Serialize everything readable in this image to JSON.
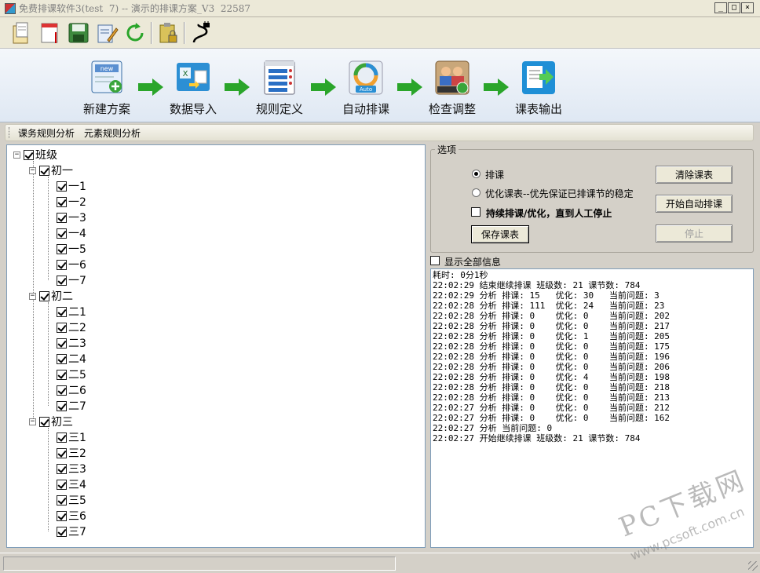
{
  "window": {
    "title": "免费排课软件3(test  7) -- 演示的排课方案_V3  22587",
    "controls": {
      "minimize": "_",
      "maximize": "□",
      "close": "×"
    }
  },
  "quick_toolbar": [
    {
      "icon": "open-folder-icon"
    },
    {
      "icon": "new-document-icon"
    },
    {
      "icon": "save-disk-icon"
    },
    {
      "icon": "edit-document-icon"
    },
    {
      "icon": "refresh-icon"
    },
    {
      "icon": "clipboard-lock-icon"
    },
    {
      "icon": "connect-plug-icon"
    }
  ],
  "workflow": [
    {
      "label": "新建方案",
      "icon": "new-plan-icon"
    },
    {
      "label": "数据导入",
      "icon": "data-import-icon"
    },
    {
      "label": "规则定义",
      "icon": "rule-list-icon"
    },
    {
      "label": "自动排课",
      "icon": "auto-schedule-icon"
    },
    {
      "label": "检查调整",
      "icon": "check-adjust-icon"
    },
    {
      "label": "课表输出",
      "icon": "export-icon"
    }
  ],
  "analysis_bar": {
    "course_rule": "课务规则分析",
    "element_rule": "元素规则分析"
  },
  "tree": {
    "root": "班级",
    "grades": [
      {
        "name": "初一",
        "classes": [
          "一1",
          "一2",
          "一3",
          "一4",
          "一5",
          "一6",
          "一7"
        ]
      },
      {
        "name": "初二",
        "classes": [
          "二1",
          "二2",
          "二3",
          "二4",
          "二5",
          "二6",
          "二7"
        ]
      },
      {
        "name": "初三",
        "classes": [
          "三1",
          "三2",
          "三3",
          "三4",
          "三5",
          "三6",
          "三7"
        ]
      }
    ]
  },
  "options": {
    "legend": "选项",
    "radio_schedule": "排课",
    "radio_optimize": "优化课表--优先保证已排课节的稳定",
    "continuous": "持续排课/优化，直到人工停止",
    "save_button": "保存课表",
    "clear_button": "清除课表",
    "start_button": "开始自动排课",
    "stop_button": "停止",
    "selected": "排课"
  },
  "log": {
    "show_all_label": "显示全部信息",
    "lines": [
      "耗时: 0分1秒",
      "22:02:29 结束继续排课 班级数: 21 课节数: 784",
      "22:02:29 分析 排课: 15   优化: 30   当前问题: 3",
      "22:02:28 分析 排课: 111  优化: 24   当前问题: 23",
      "22:02:28 分析 排课: 0    优化: 0    当前问题: 202",
      "22:02:28 分析 排课: 0    优化: 0    当前问题: 217",
      "22:02:28 分析 排课: 0    优化: 1    当前问题: 205",
      "22:02:28 分析 排课: 0    优化: 0    当前问题: 175",
      "22:02:28 分析 排课: 0    优化: 0    当前问题: 196",
      "22:02:28 分析 排课: 0    优化: 0    当前问题: 206",
      "22:02:28 分析 排课: 0    优化: 4    当前问题: 198",
      "22:02:28 分析 排课: 0    优化: 0    当前问题: 218",
      "22:02:28 分析 排课: 0    优化: 0    当前问题: 213",
      "22:02:27 分析 排课: 0    优化: 0    当前问题: 212",
      "22:02:27 分析 排课: 0    优化: 0    当前问题: 162",
      "22:02:27 分析 当前问题: 0",
      "22:02:27 开始继续排课 班级数: 21 课节数: 784"
    ]
  },
  "watermark": {
    "brand": "PC下载网",
    "site": "www.pcsoft.com.cn"
  },
  "colors": {
    "accent_green": "#2aa52a",
    "panel_gray": "#d4d0c8",
    "ribbon_blue": "#dfe8f3"
  }
}
